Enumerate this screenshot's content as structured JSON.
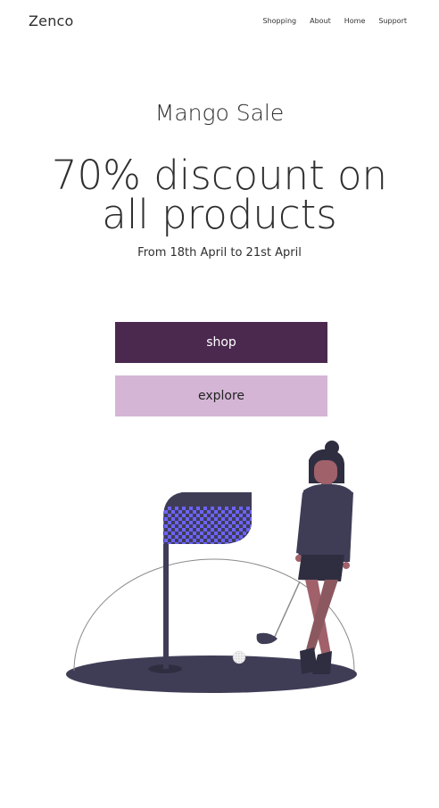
{
  "nav": {
    "brand": "Zenco",
    "links": [
      "Shopping",
      "About",
      "Home",
      "Support"
    ]
  },
  "hero": {
    "subtitle": "Mango Sale",
    "headline_line1": "70% discount on",
    "headline_line2": "all products",
    "dates": "From 18th April to 21st April"
  },
  "buttons": {
    "shop": "shop",
    "explore": "explore"
  },
  "colors": {
    "shop_bg": "#4b294f",
    "explore_bg": "#d5b5d6",
    "illustration_dark": "#3f3d56",
    "flag_accent": "#6c63ff",
    "skin": "#a0616a"
  },
  "illustration": {
    "subject": "woman golfer beside putting green flag",
    "icons": [
      "golf-flag-icon",
      "golf-ball-icon",
      "golfer-figure"
    ]
  }
}
